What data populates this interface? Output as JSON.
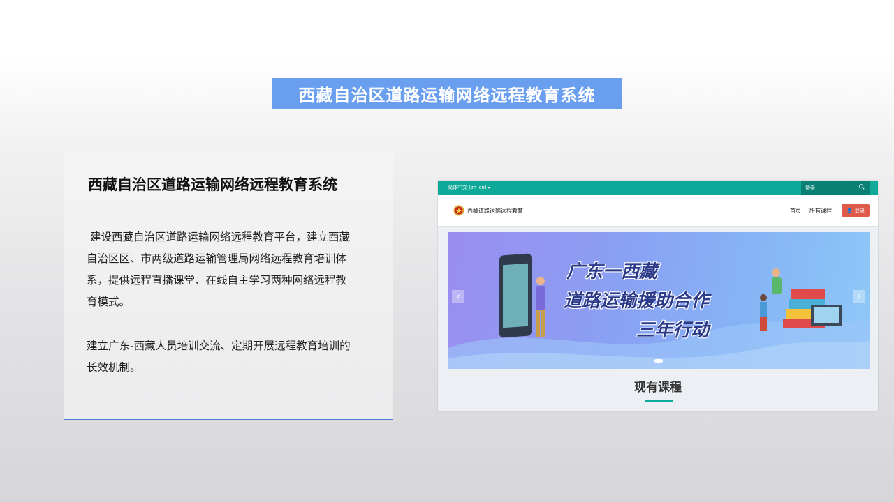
{
  "slide": {
    "banner_title": "西藏自治区道路运输网络远程教育系统"
  },
  "description": {
    "title": "西藏自治区道路运输网络远程教育系统",
    "paragraph1": "建设西藏自治区道路运输网络远程教育平台，建立西藏自治区区、市两级道路运输管理局网络远程教育培训体系，提供远程直播课堂、在线自主学习两种网络远程教育模式。",
    "paragraph2": "建立广东-西藏人员培训交流、定期开展远程教育培训的长效机制。"
  },
  "website": {
    "language": "简体中文 (zh_cn)",
    "search_placeholder": "搜索",
    "site_name": "西藏道路运输远程教育",
    "nav": {
      "home": "首页",
      "all_courses": "所有课程"
    },
    "login_label": "登录",
    "carousel": {
      "line1": "广东一西藏",
      "line2": "道路运输援助合作",
      "line3": "三年行动"
    },
    "section_title": "现有课程",
    "colors": {
      "topbar": "#0fa99a",
      "login": "#e05a4a",
      "accent": "#6a9ff0"
    }
  }
}
